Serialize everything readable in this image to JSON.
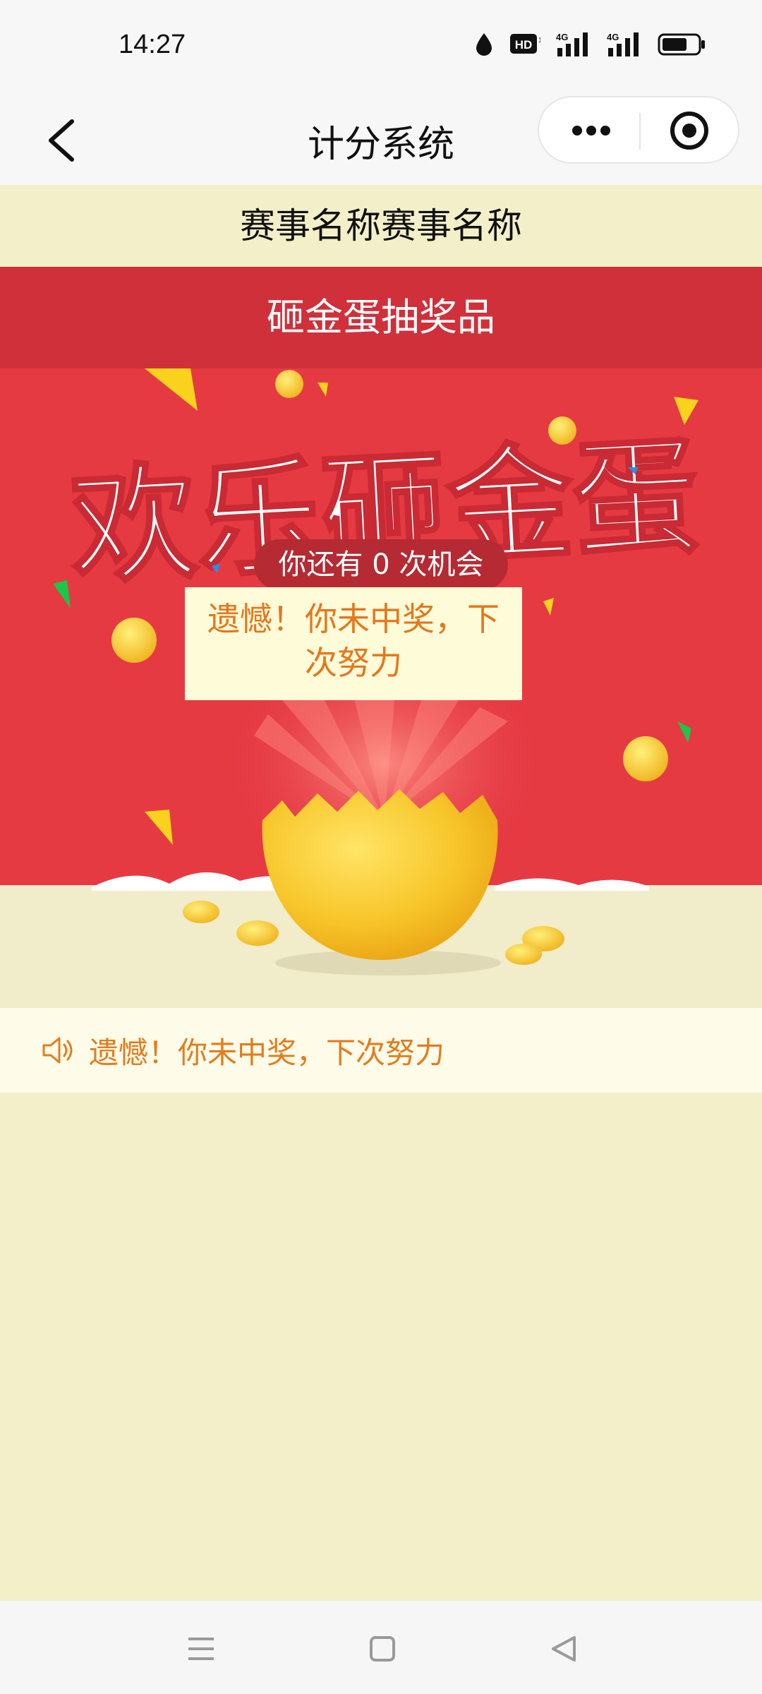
{
  "status_bar": {
    "time": "14:27",
    "icons": [
      "water-drop-icon",
      "hd-icon",
      "signal-4g-icon",
      "signal-4g-icon",
      "battery-icon"
    ],
    "hd_label": "HD",
    "signal_label": "4G"
  },
  "nav": {
    "title": "计分系统",
    "back_icon": "chevron-left-icon",
    "more_icon": "more-dots-icon",
    "close_icon": "target-circle-icon"
  },
  "event": {
    "name": "赛事名称赛事名称"
  },
  "prize": {
    "header": "砸金蛋抽奖品"
  },
  "banner": {
    "title": "欢乐砸金蛋",
    "chances_text": "你还有 0 次机会",
    "result_popup": "遗憾！你未中奖，下次努力"
  },
  "notice": {
    "icon": "speaker-icon",
    "text": "遗憾！你未中奖，下次努力"
  },
  "colors": {
    "header_red": "#d0303a",
    "banner_red": "#e63a43",
    "page_cream": "#f3efc9",
    "notice_orange": "#e27d1e",
    "egg_gold": "#f7c62a"
  },
  "system_nav": {
    "icons": [
      "menu-lines-icon",
      "home-square-icon",
      "back-triangle-icon"
    ]
  }
}
